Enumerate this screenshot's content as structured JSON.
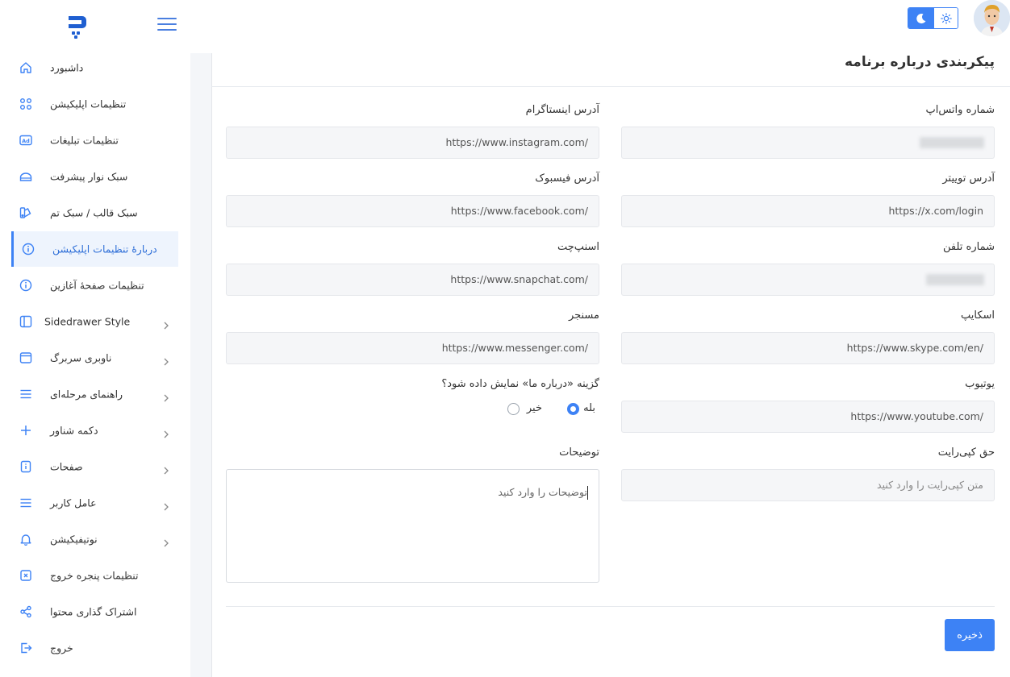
{
  "header": {
    "theme_toggle": {
      "dark_icon": "moon-icon",
      "light_icon": "sun-icon"
    },
    "avatar": "user-avatar"
  },
  "sidebar": {
    "items": [
      {
        "label": "داشبورد",
        "icon": "home-icon"
      },
      {
        "label": "تنظیمات اپلیکیشن",
        "icon": "grid-icon"
      },
      {
        "label": "تنظیمات تبلیغات",
        "icon": "ad-icon"
      },
      {
        "label": "سبک نوار پیشرفت",
        "icon": "progress-icon"
      },
      {
        "label": "سبک قالب / سبک تم",
        "icon": "palette-icon"
      },
      {
        "label": "دربارهٔ تنظیمات اپلیکیشن",
        "icon": "info-icon",
        "active": true
      },
      {
        "label": "تنظیمات صفحهٔ آغازین",
        "icon": "info-icon"
      },
      {
        "label": "Sidedrawer Style",
        "icon": "sidebar-icon",
        "has_children": true
      },
      {
        "label": "ناوبری سربرگ",
        "icon": "window-icon",
        "has_children": true
      },
      {
        "label": "راهنمای مرحله‌ای",
        "icon": "list-icon",
        "has_children": true
      },
      {
        "label": "دکمه شناور",
        "icon": "plus-icon",
        "has_children": true
      },
      {
        "label": "صفحات",
        "icon": "page-icon",
        "has_children": true
      },
      {
        "label": "عامل کاربر",
        "icon": "list-icon",
        "has_children": true
      },
      {
        "label": "نوتیفیکیشن",
        "icon": "bell-icon",
        "has_children": true
      },
      {
        "label": "تنظیمات پنجره خروج",
        "icon": "exit-window-icon"
      },
      {
        "label": "اشتراک گذاری محتوا",
        "icon": "share-icon"
      },
      {
        "label": "خروج",
        "icon": "logout-icon"
      }
    ]
  },
  "main": {
    "title": "پیکربندی درباره برنامه",
    "fields": {
      "whatsapp": {
        "label": "شماره واتس‌اپ",
        "value": ""
      },
      "instagram": {
        "label": "آدرس اینستاگرام",
        "value": "https://www.instagram.com/"
      },
      "twitter": {
        "label": "آدرس توییتر",
        "value": "https://x.com/login"
      },
      "facebook": {
        "label": "آدرس فیسبوک",
        "value": "https://www.facebook.com/"
      },
      "phone": {
        "label": "شماره تلفن",
        "value": ""
      },
      "snapchat": {
        "label": "اسنپ‌چت",
        "value": "https://www.snapchat.com/"
      },
      "skype": {
        "label": "اسکایپ",
        "value": "https://www.skype.com/en/"
      },
      "messenger": {
        "label": "مسنجر",
        "value": "https://www.messenger.com/"
      },
      "youtube": {
        "label": "یوتیوب",
        "value": "https://www.youtube.com/"
      },
      "copyright": {
        "label": "حق کپی‌رایت",
        "placeholder": "متن کپی‌رایت را وارد کنید"
      },
      "description": {
        "label": "توضیحات",
        "placeholder": "توضیحات را وارد کنید"
      }
    },
    "show_about": {
      "question": "گزینه «درباره ما» نمایش داده شود؟",
      "yes_label": "بله",
      "no_label": "خیر",
      "selected": "yes"
    },
    "save_label": "ذخیره"
  }
}
